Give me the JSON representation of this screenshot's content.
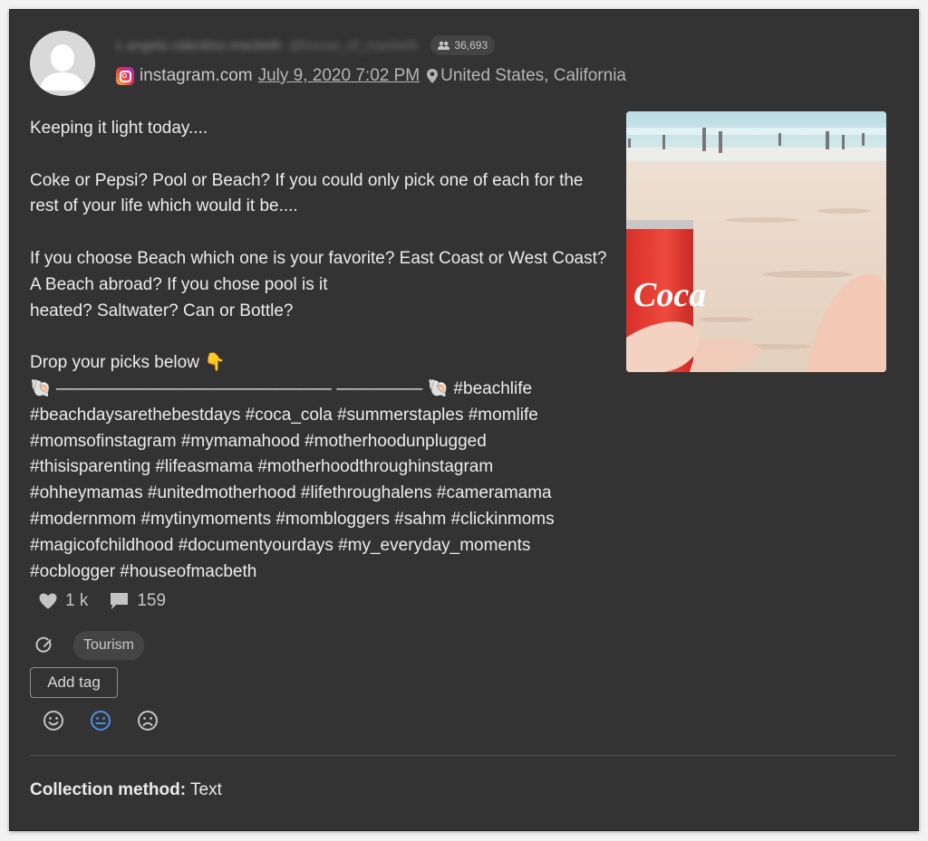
{
  "author": {
    "name": "c angela valentino macbeth",
    "handle": "@house_of_macbeth",
    "followers": "36,693"
  },
  "meta": {
    "source": "instagram.com",
    "date": "July 9, 2020 7:02 PM",
    "location": "United States, California"
  },
  "post": {
    "text": "Keeping it light today....\n\nCoke or Pepsi? Pool or Beach? If you could only pick one of each for the rest of your life which would it be....\n\nIf you choose Beach which one is your favorite? East Coast or West Coast? A Beach abroad? If you chose pool is it\nheated? Saltwater? Can or Bottle?\n\nDrop your picks below 👇\n🐚 ———————————————— ————— 🐚 #beachlife #beachdaysarethebestdays #coca_cola #summerstaples #momlife #momsofinstagram #mymamahood #motherhoodunplugged #thisisparenting #lifeasmama #motherhoodthroughinstagram #ohheymamas #unitedmotherhood #lifethroughalens #cameramama #modernmom #mytinymoments #mombloggers #sahm #clickinmoms #magicofchildhood #documentyourdays #my_everyday_moments #ocblogger #houseofmacbeth"
  },
  "image": {
    "can_text": "Coca"
  },
  "stats": {
    "likes": "1 k",
    "comments": "159"
  },
  "topic": "Tourism",
  "add_tag_label": "Add tag",
  "sentiment": {
    "selected": "neutral",
    "highlight_color": "#4a90e2"
  },
  "collection": {
    "label": "Collection method:",
    "value": "Text"
  },
  "icons": {
    "avatar": "person-silhouette-icon",
    "followers": "people-icon",
    "source": "instagram-icon",
    "location": "map-pin-icon",
    "likes": "heart-icon",
    "comments": "comment-icon",
    "topic": "topic-gauge-icon",
    "sentiments": [
      "positive-face-icon",
      "neutral-face-icon",
      "negative-face-icon"
    ]
  }
}
